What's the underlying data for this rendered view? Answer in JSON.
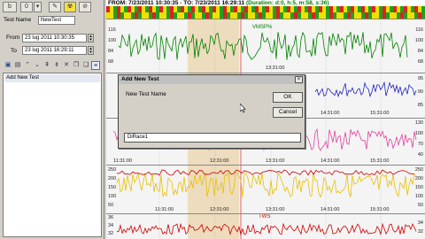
{
  "toolbar": {
    "items": [
      "b",
      "0",
      "▾",
      "✎",
      "☢",
      "⊘"
    ]
  },
  "test_form": {
    "name_label": "Test Name",
    "name_value": "NewTest",
    "from_label": "From",
    "from_value": "23 lug  2011 10:30:35",
    "to_label": "To",
    "to_value": "23 lug  2011 16:29:11"
  },
  "test_list": {
    "items": [
      "Add New Test"
    ]
  },
  "header": {
    "range_text": "FROM: 7/23/2011 10:30:35 - TO: 7/23/2011 16:29:11",
    "duration_text": "(Duration: d:0, h:5, m:58, s:36)"
  },
  "panels": {
    "p1": {
      "y_ticks": [
        "116",
        "108",
        "100",
        "92",
        "84",
        "76",
        "68",
        "60"
      ],
      "right_ticks": [
        "116",
        "108",
        "100",
        "92",
        "84",
        "76",
        "68"
      ],
      "series_label": "VMSP%",
      "time_label": "13:31:00"
    },
    "p2": {
      "right_ticks": [
        "95",
        "90",
        "85"
      ],
      "x_labels": [
        "14:31:00",
        "15:31:00"
      ]
    },
    "p3": {
      "right_ticks": [
        "130",
        "100",
        "70",
        "40"
      ],
      "x_labels": [
        "11:31:00",
        "12:31:00",
        "13:31:00",
        "14:31:00",
        "15:31:00"
      ]
    },
    "p4": {
      "y_ticks": [
        "250",
        "200",
        "150",
        "100",
        "50"
      ],
      "right_ticks": [
        "250",
        "200",
        "150",
        "100",
        "50"
      ],
      "x_labels": [
        "11:31:00",
        "12:31:00",
        "13:31:00",
        "14:31:00",
        "15:31:00"
      ]
    },
    "p5": {
      "y_ticks": [
        "36",
        "34",
        "32"
      ],
      "right_ticks": [
        "34",
        "32"
      ],
      "series_label": "TWS"
    }
  },
  "dialog": {
    "title": "Add New Test",
    "name_label": "New Test Name",
    "ok_label": "OK",
    "cancel_label": "Cancel",
    "input_value": "DiRace1",
    "close_label": "×"
  },
  "colors": {
    "green_series": "#008000",
    "blue_series": "#2020c0",
    "pink_series": "#e040a0",
    "yellow_series": "#e8c000",
    "red_series": "#d00000",
    "highlight": "#e8c890"
  }
}
